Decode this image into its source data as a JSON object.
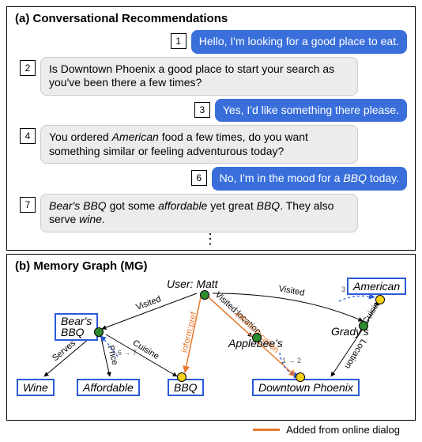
{
  "sections": {
    "a_title": "(a) Conversational Recommendations",
    "b_title": "(b) Memory Graph (MG)"
  },
  "turns": {
    "t1": "Hello, I'm looking for a good place to eat.",
    "t2": "Is Downtown Phoenix a good place to start your search as you've been there a few times?",
    "t3": "Yes, I'd like something there please.",
    "t4_a": "You ordered ",
    "t4_b": "American",
    "t4_c": " food a few times, do you want something similar or feeling adventurous today?",
    "t6_a": "No, I'm in the mood for a ",
    "t6_b": "BBQ",
    "t6_c": " today.",
    "t7_a": "Bear's BBQ",
    "t7_b": " got some ",
    "t7_c": "affordable",
    "t7_d": " yet great ",
    "t7_e": "BBQ",
    "t7_f": ". They also serve ",
    "t7_g": "wine",
    "t7_h": "."
  },
  "nums": {
    "n1": "1",
    "n2": "2",
    "n3": "3",
    "n4": "4",
    "n6": "6",
    "n7": "7"
  },
  "graph": {
    "user_label": "User: Matt",
    "nodes": {
      "american": "American",
      "bears": "Bear's\nBBQ",
      "wine": "Wine",
      "affordable": "Affordable",
      "bbq": "BBQ",
      "applebees": "Applebee's",
      "gradys": "Grady's",
      "downtown": "Downtown Phoenix"
    },
    "edges": {
      "visited": "Visited",
      "inform_pref": "inform:pref",
      "visited_loc": "Visited:location",
      "inform_loc": "inform:location",
      "cuisine": "Cuisine",
      "serves": "Serves",
      "price": "Price",
      "location": "Location",
      "step34": "3 → 4",
      "step12": "1 → 2",
      "step67": "6 → 7"
    }
  },
  "legend": {
    "label": "Added from online dialog"
  }
}
